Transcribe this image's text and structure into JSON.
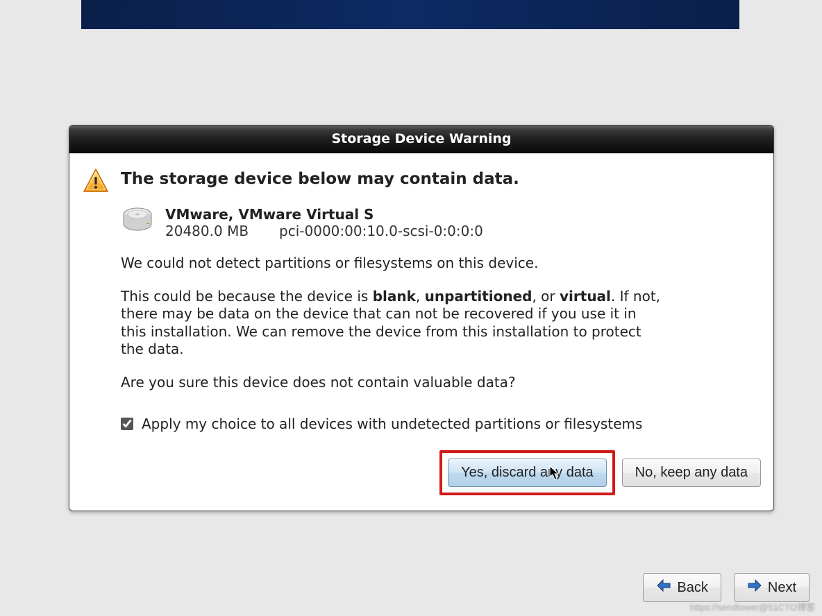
{
  "dialog": {
    "title": "Storage Device Warning",
    "headline": "The storage device below may contain data.",
    "device": {
      "name": "VMware, VMware Virtual S",
      "size": "20480.0 MB",
      "path": "pci-0000:00:10.0-scsi-0:0:0:0"
    },
    "para1": "We could not detect partitions or filesystems on this device.",
    "para2_lead": "This could be because the device is ",
    "para2_b1": "blank",
    "para2_sep1": ", ",
    "para2_b2": "unpartitioned",
    "para2_sep2": ", or ",
    "para2_b3": "virtual",
    "para2_tail": ". If not, there may be data on the device that can not be recovered if you use it in this installation. We can remove the device from this installation to protect the data.",
    "confirm": "Are you sure this device does not contain valuable data?",
    "apply_label": "Apply my choice to all devices with undetected partitions or filesystems",
    "apply_checked": true,
    "yes_label": "Yes, discard any data",
    "no_label": "No, keep any data"
  },
  "footer": {
    "back": "Back",
    "next": "Next"
  },
  "watermark": "https://sendtower@51CTO博客"
}
